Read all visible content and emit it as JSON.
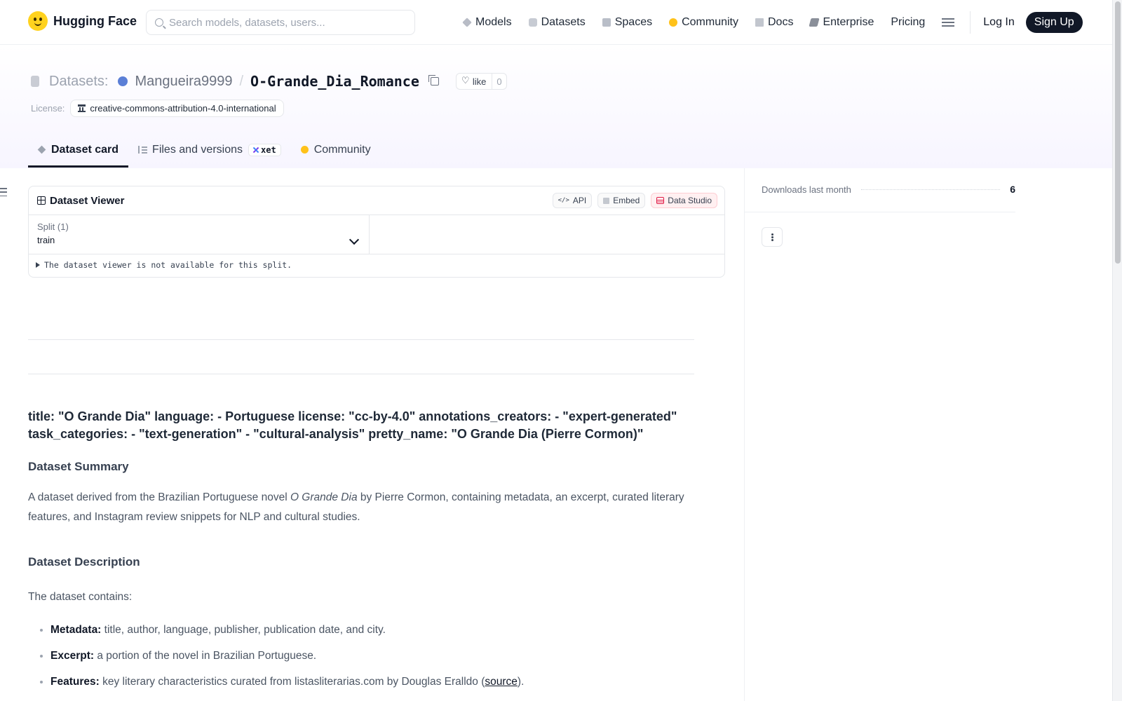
{
  "nav": {
    "brand": "Hugging Face",
    "search_placeholder": "Search models, datasets, users...",
    "links": [
      "Models",
      "Datasets",
      "Spaces",
      "Community",
      "Docs",
      "Enterprise",
      "Pricing"
    ],
    "login": "Log In",
    "signup": "Sign Up"
  },
  "repo": {
    "type_label": "Datasets:",
    "owner": "Mangueira9999",
    "separator": "/",
    "name": "O-Grande_Dia_Romance",
    "like_label": "like",
    "like_count": "0",
    "license_label": "License:",
    "license_value": "creative-commons-attribution-4.0-international"
  },
  "tabs": [
    {
      "label": "Dataset card",
      "active": true
    },
    {
      "label": "Files and versions",
      "badge": "xet"
    },
    {
      "label": "Community"
    }
  ],
  "viewer": {
    "title": "Dataset Viewer",
    "api_label": "API",
    "embed_label": "Embed",
    "data_studio_label": "Data Studio",
    "split_label": "Split (1)",
    "split_value": "train",
    "note": "The dataset viewer is not available for this split."
  },
  "card": {
    "meta_heading": "title: \"O Grande Dia\" language: - Portuguese license: \"cc-by-4.0\" annotations_creators: - \"expert-generated\" task_categories: - \"text-generation\" - \"cultural-analysis\" pretty_name: \"O Grande Dia (Pierre Cormon)\"",
    "summary_heading": "Dataset Summary",
    "summary_pre": "A dataset derived from the Brazilian Portuguese novel ",
    "summary_title": "O Grande Dia",
    "summary_post": " by Pierre Cormon, containing metadata, an excerpt, curated literary features, and Instagram review snippets for NLP and cultural studies.",
    "description_heading": "Dataset Description",
    "contains": "The dataset contains:",
    "items": [
      {
        "term": "Metadata:",
        "text": " title, author, language, publisher, publication date, and city."
      },
      {
        "term": "Excerpt:",
        "text": " a portion of the novel in Brazilian Portuguese."
      },
      {
        "term": "Features:",
        "text": " key literary characteristics curated from listasliterarias.com by Douglas Eralldo (",
        "link": "source",
        "tail": ")."
      }
    ]
  },
  "sidebar": {
    "downloads_label": "Downloads last month",
    "downloads_value": "6"
  }
}
